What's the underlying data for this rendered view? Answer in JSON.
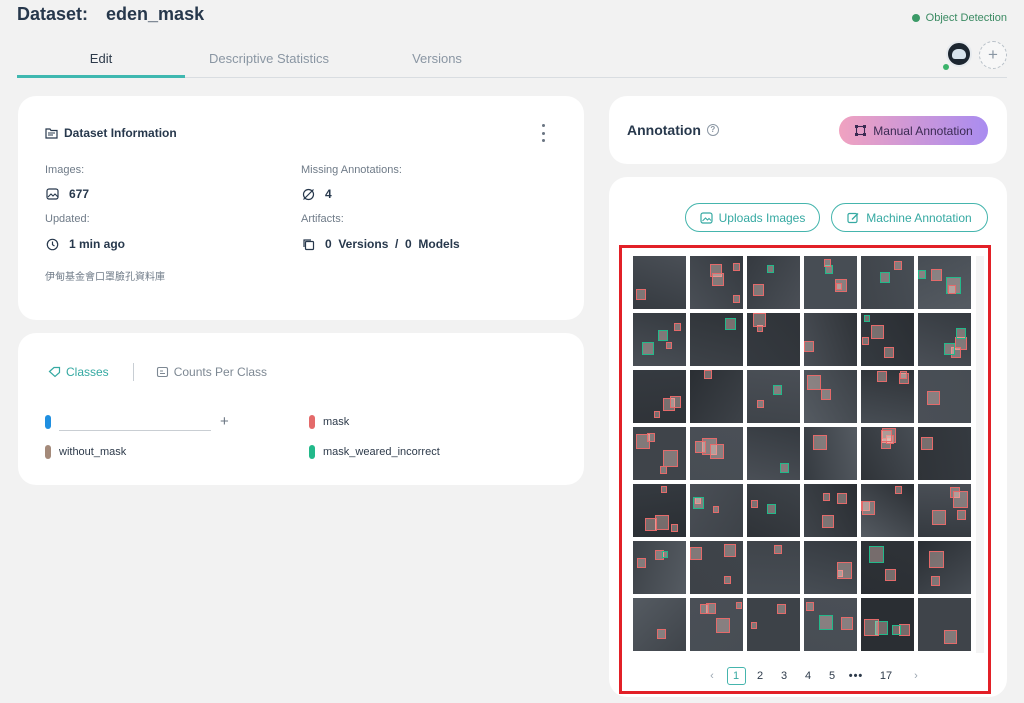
{
  "header": {
    "dataset_label": "Dataset:",
    "dataset_name": "eden_mask",
    "task_type": "Object Detection",
    "task_color": "#3b9a67"
  },
  "tabs": [
    {
      "label": "Edit",
      "active": true
    },
    {
      "label": "Descriptive Statistics",
      "active": false
    },
    {
      "label": "Versions",
      "active": false
    }
  ],
  "dataset_info": {
    "title": "Dataset Information",
    "images_label": "Images:",
    "images_value": "677",
    "missing_label": "Missing Annotations:",
    "missing_value": "4",
    "updated_label": "Updated:",
    "updated_value": "1 min ago",
    "artifacts_label": "Artifacts:",
    "artifacts_value": "0  Versions  /  0  Models",
    "description": "伊甸基金會口罩臉孔資料庫"
  },
  "classes_panel": {
    "classes_tab": "Classes",
    "counts_tab": "Counts Per Class",
    "new_class_value": "",
    "items": [
      {
        "name": "mask",
        "color": "#e46a6a"
      },
      {
        "name": "without_mask",
        "color": "#a48a7a"
      },
      {
        "name": "mask_weared_incorrect",
        "color": "#22b98a"
      }
    ],
    "new_class_color": "#1f8fe0"
  },
  "annotation": {
    "title": "Annotation",
    "manual_button": "Manual Annotation",
    "upload_button": "Uploads Images",
    "machine_button": "Machine Annotation"
  },
  "gallery": {
    "rows": 7,
    "cols": 6,
    "box_colors": [
      "#e46a6a",
      "#22b98a"
    ]
  },
  "pagination": {
    "pages": [
      "1",
      "2",
      "3",
      "4",
      "5"
    ],
    "ellipsis": "•••",
    "last_page": "17",
    "current": "1",
    "prev": "‹",
    "next": "›"
  }
}
